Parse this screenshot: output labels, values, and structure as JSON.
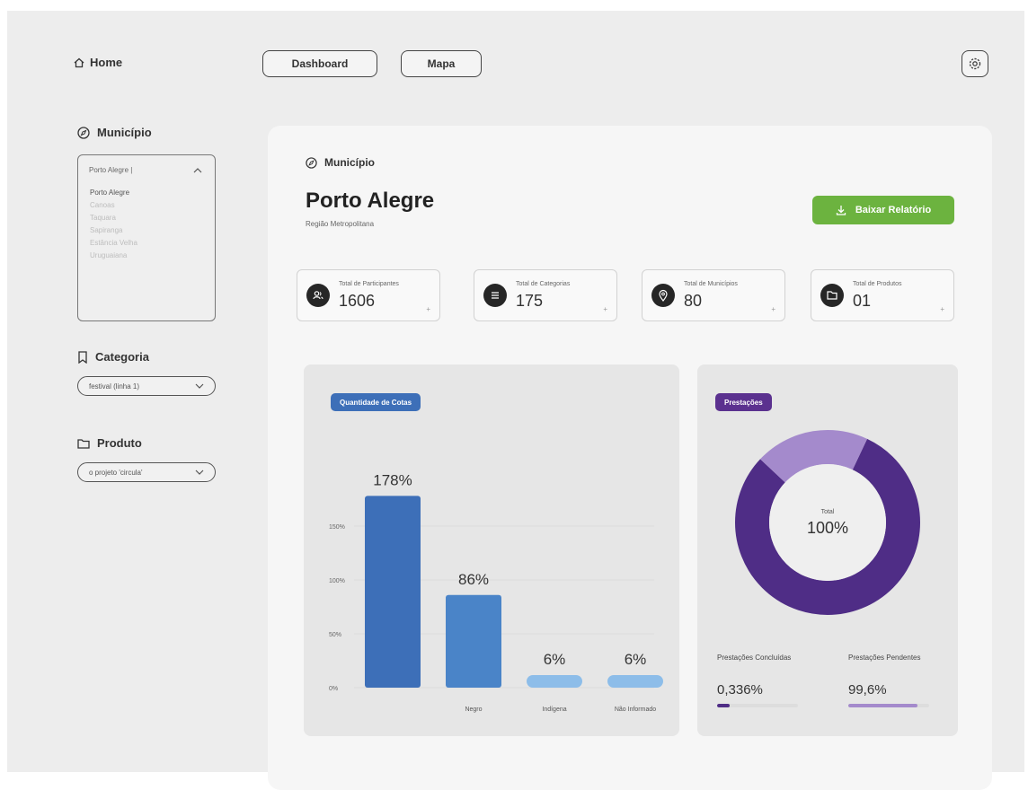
{
  "nav": {
    "home_label": "Home",
    "dashboard_label": "Dashboard",
    "mapa_label": "Mapa",
    "settings_icon": "gear-icon"
  },
  "sidebar": {
    "municipio": {
      "title": "Município",
      "selected": "Porto Alegre |",
      "options": [
        "Porto Alegre",
        "Canoas",
        "Taquara",
        "Sapiranga",
        "Estância Velha",
        "Uruguaiana"
      ]
    },
    "categoria": {
      "title": "Categoria",
      "selected": "festival (linha 1)"
    },
    "produto": {
      "title": "Produto",
      "selected": "o projeto 'circula'"
    }
  },
  "main": {
    "section_label": "Município",
    "city": "Porto Alegre",
    "region": "Região Metropolitana",
    "download_label": "Baixar Relatório",
    "accent_color": "#6cb33f",
    "stats": [
      {
        "label": "Total de Participantes",
        "value": "1606",
        "icon": "users-icon"
      },
      {
        "label": "Total de Categorias",
        "value": "175",
        "icon": "list-icon"
      },
      {
        "label": "Total de Municípios",
        "value": "80",
        "icon": "pin-icon"
      },
      {
        "label": "Total de Produtos",
        "value": "01",
        "icon": "folder-icon"
      }
    ]
  },
  "chart_data": [
    {
      "type": "bar",
      "title": "Quantidade de Cotas",
      "categories": [
        "",
        "Negro",
        "Indígena",
        "Não Informado"
      ],
      "values": [
        178,
        86,
        6,
        6
      ],
      "data_labels": [
        "178%",
        "86%",
        "6%",
        "6%"
      ],
      "ytick_labels": [
        "0%",
        "50%",
        "100%",
        "150%"
      ],
      "ylim": [
        0,
        200
      ],
      "colors": [
        "#3d6fb8",
        "#4a84c8",
        "#8dbde9",
        "#8dbde9"
      ]
    },
    {
      "type": "pie",
      "title": "Prestações",
      "center_label": "Total",
      "center_value": "100%",
      "slices": [
        {
          "name": "Prestações Concluídas",
          "label": "0,336%",
          "value": 0.336,
          "color": "#4f2d86"
        },
        {
          "name": "Prestações Pendentes",
          "label": "99,6%",
          "value": 99.6,
          "color": "#a48acc"
        }
      ]
    }
  ]
}
